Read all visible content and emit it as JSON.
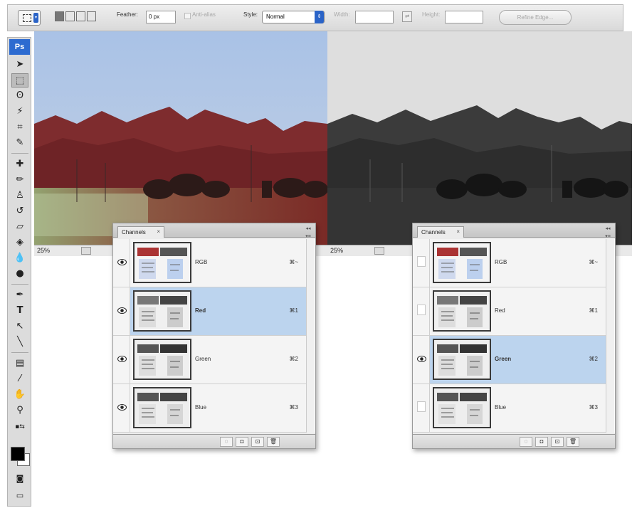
{
  "options_bar": {
    "feather_label": "Feather:",
    "feather_value": "0 px",
    "anti_alias_label": "Anti-alias",
    "style_label": "Style:",
    "style_value": "Normal",
    "width_label": "Width:",
    "height_label": "Height:",
    "refine_edge_label": "Refine Edge..."
  },
  "toolbox": {
    "logo": "Ps"
  },
  "documents": {
    "left": {
      "zoom": "25%"
    },
    "right": {
      "zoom": "25%"
    }
  },
  "channels_left": {
    "tab_label": "Channels",
    "tab_close": "×",
    "rows": [
      {
        "name": "RGB",
        "shortcut": "⌘~",
        "visible": true,
        "active": false
      },
      {
        "name": "Red",
        "shortcut": "⌘1",
        "visible": true,
        "active": true
      },
      {
        "name": "Green",
        "shortcut": "⌘2",
        "visible": true,
        "active": false
      },
      {
        "name": "Blue",
        "shortcut": "⌘3",
        "visible": true,
        "active": false
      }
    ]
  },
  "channels_right": {
    "tab_label": "Channels",
    "tab_close": "×",
    "rows": [
      {
        "name": "RGB",
        "shortcut": "⌘~",
        "visible": false,
        "active": false
      },
      {
        "name": "Red",
        "shortcut": "⌘1",
        "visible": false,
        "active": false
      },
      {
        "name": "Green",
        "shortcut": "⌘2",
        "visible": true,
        "active": true
      },
      {
        "name": "Blue",
        "shortcut": "⌘3",
        "visible": false,
        "active": false
      }
    ]
  },
  "colors": {
    "accent": "#2d6bd0",
    "active_row": "#bcd4ee"
  }
}
